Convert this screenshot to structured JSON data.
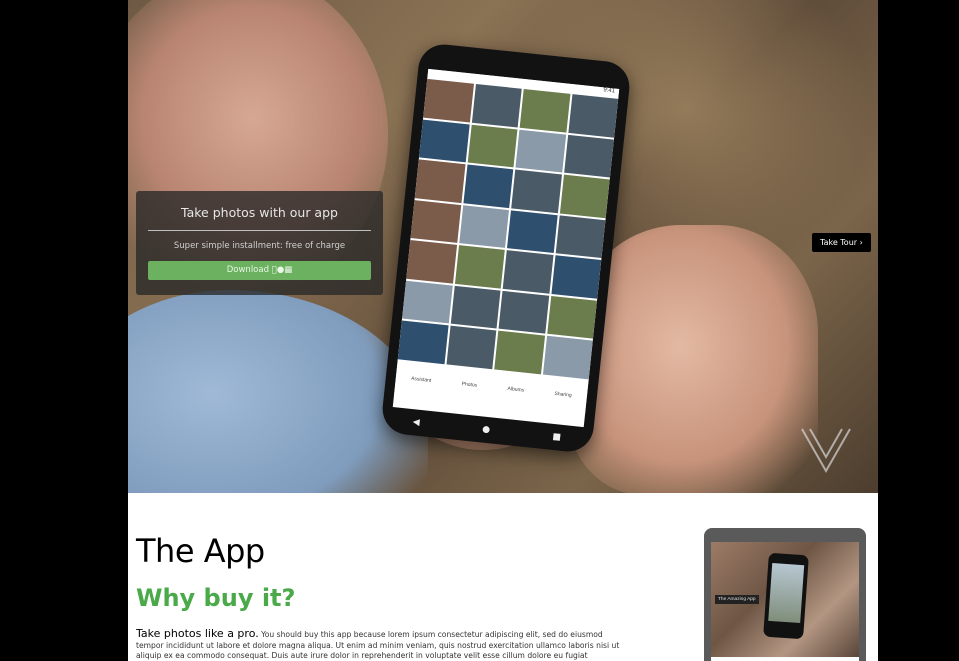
{
  "hero": {
    "overlay_title": "Take photos with our app",
    "overlay_subtitle": "Super simple installment: free of charge",
    "download_label": "Download",
    "download_icons": [
      "apple-icon",
      "android-icon",
      "windows-icon"
    ],
    "tour_label": "Take Tour ›",
    "accent_color": "#6bb15f",
    "phone_nav": [
      "Assistant",
      "Photos",
      "Albums",
      "Sharing"
    ],
    "phone_time": "9:41"
  },
  "content": {
    "title": "The App",
    "subtitle": "Why buy it?",
    "subtitle_color": "#4aaa4a",
    "lead": "Take photos like a pro.",
    "body": "You should buy this app because lorem ipsum consectetur adipiscing elit, sed do eiusmod tempor incididunt ut labore et dolore magna aliqua. Ut enim ad minim veniam, quis nostrud exercitation ullamco laboris nisi ut aliquip ex ea commodo consequat. Duis aute irure dolor in reprehenderit in voluptate velit esse cillum dolore eu fugiat",
    "tablet_label": "The Amazing App"
  }
}
